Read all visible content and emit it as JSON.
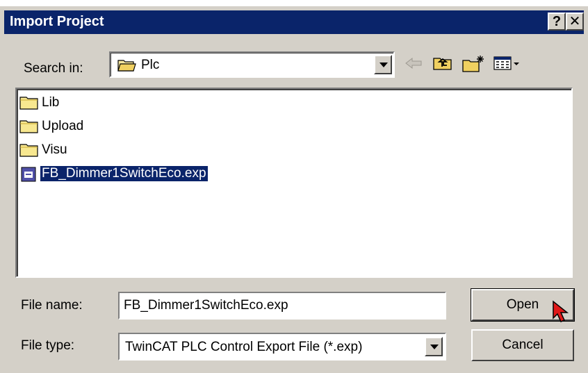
{
  "window": {
    "title": "Import Project",
    "help_label": "?",
    "close_label": "✕"
  },
  "search": {
    "label": "Search in:",
    "current_folder": "Plc"
  },
  "toolbar": {
    "back_icon": "back-arrow-icon",
    "up_icon": "up-one-level-icon",
    "new_folder_icon": "new-folder-icon",
    "view_icon": "view-menu-icon"
  },
  "files": [
    {
      "name": "Lib",
      "type": "folder",
      "selected": false
    },
    {
      "name": "Upload",
      "type": "folder",
      "selected": false
    },
    {
      "name": "Visu",
      "type": "folder",
      "selected": false
    },
    {
      "name": "FB_Dimmer1SwitchEco.exp",
      "type": "exp-file",
      "selected": true
    }
  ],
  "form": {
    "file_name_label": "File name:",
    "file_name_value": "FB_Dimmer1SwitchEco.exp",
    "file_type_label": "File type:",
    "file_type_value": "TwinCAT PLC Control Export File (*.exp)"
  },
  "buttons": {
    "open": "Open",
    "cancel": "Cancel"
  },
  "colors": {
    "titlebar": "#0a246a",
    "face": "#d4d0c8",
    "selection": "#0a246a"
  }
}
